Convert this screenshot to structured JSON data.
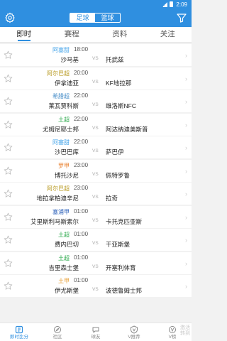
{
  "status_bar": {
    "time": "2:09"
  },
  "header": {
    "segments": [
      {
        "label": "足球",
        "active": true
      },
      {
        "label": "篮球",
        "active": false
      }
    ]
  },
  "tabs": [
    {
      "label": "即时",
      "active": true
    },
    {
      "label": "赛程",
      "active": false
    },
    {
      "label": "资料",
      "active": false
    },
    {
      "label": "关注",
      "active": false
    }
  ],
  "matches": [
    {
      "league": "阿塞甜",
      "league_color": "#3da0e8",
      "time": "18:00",
      "home": "沙马基",
      "away": "托武兹"
    },
    {
      "league": "阿尔巴超",
      "league_color": "#b89a22",
      "time": "20:00",
      "home": "伊拿迪亚",
      "away": "KF地拉那"
    },
    {
      "league": "希腊超",
      "league_color": "#4a8fc9",
      "time": "22:00",
      "home": "莱瓦贾科斯",
      "away": "维洛斯NFC"
    },
    {
      "league": "土超",
      "league_color": "#2aa84a",
      "time": "22:00",
      "home": "尤姆尼耶士邦",
      "away": "阿达纳迪美斯普"
    },
    {
      "league": "阿塞甜",
      "league_color": "#3da0e8",
      "time": "22:00",
      "home": "沙巴巴库",
      "away": "萨巴伊"
    },
    {
      "league": "罗甲",
      "league_color": "#e87d2a",
      "time": "23:00",
      "home": "博托沙尼",
      "away": "佩特罗鲁"
    },
    {
      "league": "阿尔巴超",
      "league_color": "#b89a22",
      "time": "23:00",
      "home": "地拉拿柏迪辛尼",
      "away": "拉奇"
    },
    {
      "league": "塞浦甲",
      "league_color": "#2a5fb8",
      "time": "01:00",
      "home": "艾里斯利马斯素尔",
      "away": "卡托克匹亚斯"
    },
    {
      "league": "土超",
      "league_color": "#2aa84a",
      "time": "01:00",
      "home": "费内巴切",
      "away": "干亚斯堡"
    },
    {
      "league": "土超",
      "league_color": "#2aa84a",
      "time": "01:00",
      "home": "吉里森士堡",
      "away": "开塞利体育"
    },
    {
      "league": "土甲",
      "league_color": "#e8a23a",
      "time": "01:00",
      "home": "伊尤斯堡",
      "away": "波德鲁姆士邦"
    }
  ],
  "vs_label": "VS",
  "bottom_nav": [
    {
      "label": "即时比分",
      "icon": "scoreboard-icon",
      "active": true
    },
    {
      "label": "社区",
      "icon": "compass-icon",
      "active": false
    },
    {
      "label": "球友",
      "icon": "chat-icon",
      "active": false
    },
    {
      "label": "V推荐",
      "icon": "v-shield-icon",
      "active": false
    },
    {
      "label": "V榜",
      "icon": "v-badge-icon",
      "active": false
    }
  ],
  "watermark": {
    "line1": "激活",
    "line2": "转到"
  },
  "colors": {
    "brand": "#2f8fe0"
  }
}
